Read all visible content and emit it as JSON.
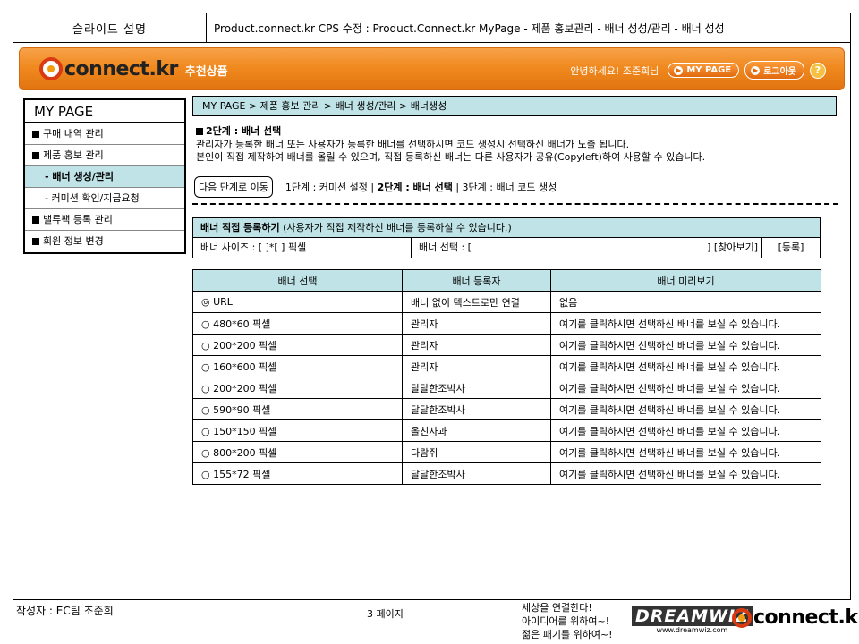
{
  "titlebar": {
    "slide_title": "슬라이드 설명",
    "slide_path": "Product.connect.kr CPS 수정 : Product.Connect.kr MyPage - 제품 홍보관리 - 배너 성성/관리 - 배너 성성"
  },
  "header": {
    "logo_text": "connect.kr",
    "logo_tag": "추천상품",
    "greeting": "안녕하세요! 조준희님",
    "mypage_label": "MY PAGE",
    "logout_label": "로그아웃",
    "help_label": "?"
  },
  "sidebar": {
    "title": "MY PAGE",
    "items": [
      {
        "label": "구매 내역 관리"
      },
      {
        "label": "제품 홍보 관리"
      },
      {
        "label": "- 배너 생성/관리"
      },
      {
        "label": "- 커미션 확인/지급요청"
      },
      {
        "label": "밸류팩 등록 관리"
      },
      {
        "label": "회원 정보 변경"
      }
    ]
  },
  "content": {
    "breadcrumb": "MY PAGE > 제품 홍보 관리 > 배너 생성/관리 > 배너생성",
    "step_title": "2단계 : 배너 선택",
    "desc_line1": "관리자가 등록한 배너 또는 사용자가 등록한 배너를 선택하시면 코드 생성시 선택하신 배너가 노출 됩니다.",
    "desc_line2": "본인이 직접 제작하여 배너를 올릴 수 있으며, 직접 등록하신 배너는 다른 사용자가 공유(Copyleft)하여 사용할 수 있습니다.",
    "next_button": "다음 단계로 이동",
    "step1": "1단계 : 커미션 설정 |",
    "step2": "2단계 : 배너 선택",
    "step3": "| 3단계 : 배너 코드 생성"
  },
  "register": {
    "head_bold": "배너 직접 등록하기",
    "head_rest": " (사용자가 직접 제작하신 배너를 등록하실 수 있습니다.)",
    "size_label": "배너 사이즈 : [          ]*[          ] 픽셀",
    "select_label": "배너 선택 : [",
    "select_end": "] [찾아보기]",
    "register_button": "[등록]"
  },
  "table": {
    "headers": [
      "배너 선택",
      "배너 등록자",
      "배너 미리보기"
    ],
    "rows": [
      {
        "sel": "◎ URL",
        "owner": "배너 없이 텍스트로만 연결",
        "preview": "없음"
      },
      {
        "sel": "○ 480*60 픽셀",
        "owner": "관리자",
        "preview": "여기를 클릭하시면 선택하신 배너를 보실 수 있습니다."
      },
      {
        "sel": "○ 200*200 픽셀",
        "owner": "관리자",
        "preview": "여기를 클릭하시면 선택하신 배너를 보실 수 있습니다."
      },
      {
        "sel": "○ 160*600 픽셀",
        "owner": "관리자",
        "preview": "여기를 클릭하시면 선택하신 배너를 보실 수 있습니다."
      },
      {
        "sel": "○ 200*200 픽셀",
        "owner": "달달한조박사",
        "preview": "여기를 클릭하시면 선택하신 배너를 보실 수 있습니다."
      },
      {
        "sel": "○ 590*90 픽셀",
        "owner": "달달한조박사",
        "preview": "여기를 클릭하시면 선택하신 배너를 보실 수 있습니다."
      },
      {
        "sel": "○ 150*150 픽셀",
        "owner": "올친사과",
        "preview": "여기를 클릭하시면 선택하신 배너를 보실 수 있습니다."
      },
      {
        "sel": "○ 800*200 픽셀",
        "owner": "다람쥐",
        "preview": "여기를 클릭하시면 선택하신 배너를 보실 수 있습니다."
      },
      {
        "sel": "○ 155*72 픽셀",
        "owner": "달달한조박사",
        "preview": "여기를 클릭하시면 선택하신 배너를 보실 수 있습니다."
      }
    ]
  },
  "footer": {
    "author": "작성자 : EC팀 조준희",
    "page": "3 페이지",
    "slogan1": "세상을 연결한다!",
    "slogan2": "아이디어를 위하여~!",
    "slogan3": "젊은 패기를 위하여~!",
    "dw_big": "DREAMWIZ",
    "dw_small": "www.dreamwiz.com",
    "logo_text": "connect.kr"
  },
  "colors": {
    "header_orange": "#f08a1f",
    "light_cyan": "#bfe3e6",
    "logo_red": "#d83a12"
  }
}
